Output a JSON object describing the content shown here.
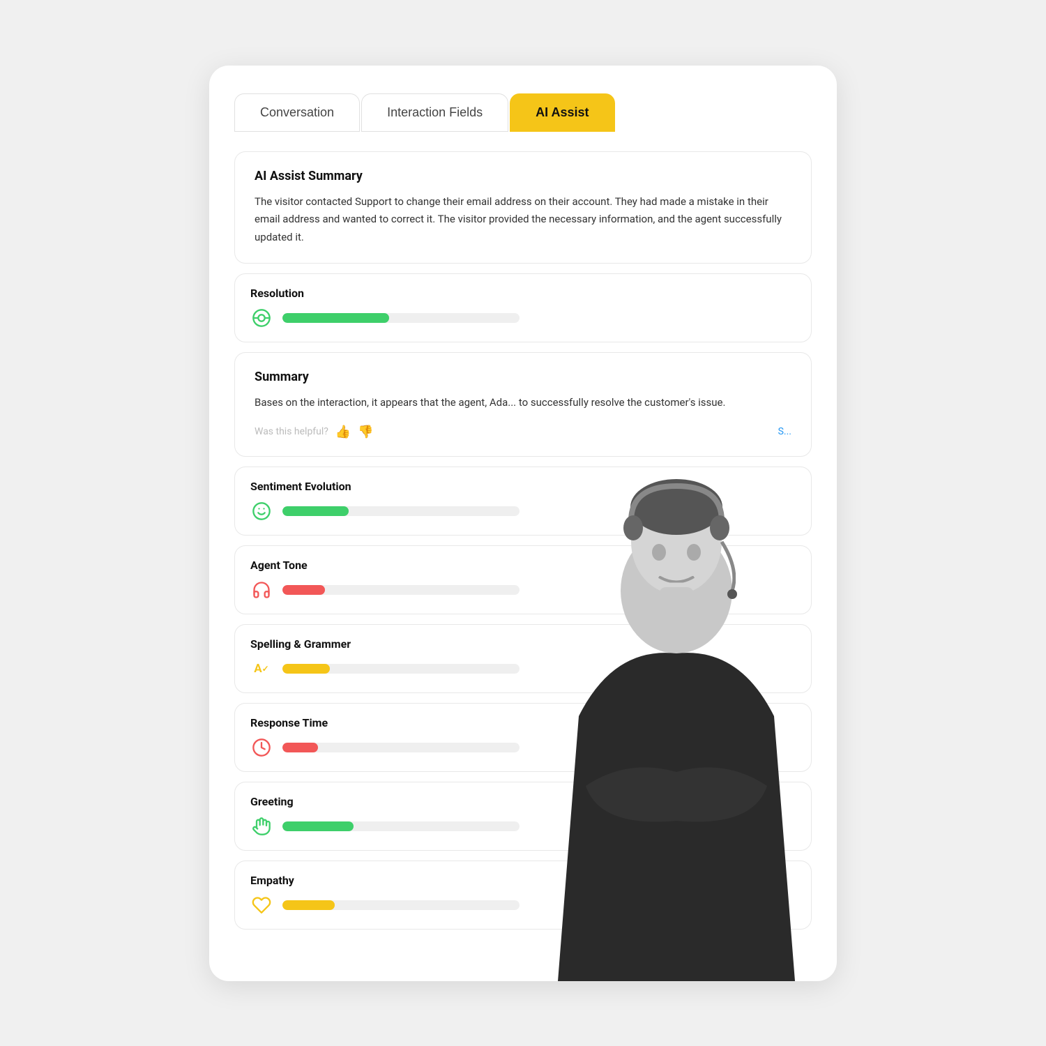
{
  "tabs": [
    {
      "id": "conversation",
      "label": "Conversation",
      "active": false
    },
    {
      "id": "interaction-fields",
      "label": "Interaction Fields",
      "active": false
    },
    {
      "id": "ai-assist",
      "label": "AI Assist",
      "active": true
    }
  ],
  "ai_assist_summary": {
    "title": "AI Assist Summary",
    "text": "The visitor contacted Support to change their email address on their account. They had made a mistake in their email address and wanted to correct it. The visitor provided the necessary information, and the agent successfully updated it."
  },
  "resolution": {
    "title": "Resolution",
    "icon": "👁",
    "icon_color": "#3ECF6A",
    "bar_color": "green",
    "bar_width": "45%"
  },
  "summary": {
    "title": "Summary",
    "text": "Bases on the interaction, it appears that the agent, Ada... to successfully resolve the customer's issue.",
    "helpful_label": "Was this helpful?",
    "thumbs_up": "👍",
    "thumbs_down": "👎",
    "see_more": "S..."
  },
  "sentiment_evolution": {
    "title": "Sentiment Evolution",
    "icon": "🙂",
    "icon_color": "#3ECF6A",
    "bar_color": "green",
    "bar_width": "28%"
  },
  "agent_tone": {
    "title": "Agent Tone",
    "icon": "🎧",
    "icon_color": "#F25757",
    "bar_color": "red",
    "bar_width": "18%"
  },
  "spelling_grammar": {
    "title": "Spelling & Grammer",
    "icon": "A✓",
    "icon_color": "#F5C518",
    "bar_color": "yellow",
    "bar_width": "20%"
  },
  "response_time": {
    "title": "Response Time",
    "icon": "⏱",
    "icon_color": "#F25757",
    "bar_color": "red",
    "bar_width": "15%"
  },
  "greeting": {
    "title": "Greeting",
    "icon": "🤝",
    "icon_color": "#3ECF6A",
    "bar_color": "green",
    "bar_width": "30%"
  },
  "empathy": {
    "title": "Empathy",
    "icon": "🤍",
    "icon_color": "#F5C518",
    "bar_color": "yellow",
    "bar_width": "22%"
  }
}
